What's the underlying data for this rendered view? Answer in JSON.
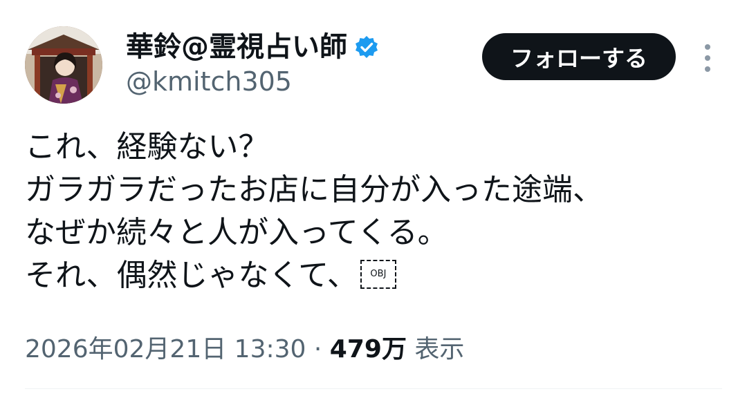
{
  "author": {
    "display_name": "華鈴@霊視占い師",
    "handle": "@kmitch305",
    "verified": true
  },
  "actions": {
    "follow_label": "フォローする",
    "more_icon": "more-vertical-icon"
  },
  "tweet": {
    "lines": [
      "これ、経験ない？",
      "ガラガラだったお店に自分が入った途端、",
      "なぜか続々と人が入ってくる。",
      "それ、偶然じゃなくて、"
    ],
    "obj_placeholder": "OBJ"
  },
  "meta": {
    "datetime": "2026年02月21日 13:30",
    "separator": "·",
    "views_count": "479万",
    "views_label": "表示"
  },
  "colors": {
    "text": "#0f1419",
    "secondary": "#536471",
    "verified_blue": "#1d9bf0",
    "button_bg": "#0f1419",
    "button_text": "#ffffff"
  }
}
